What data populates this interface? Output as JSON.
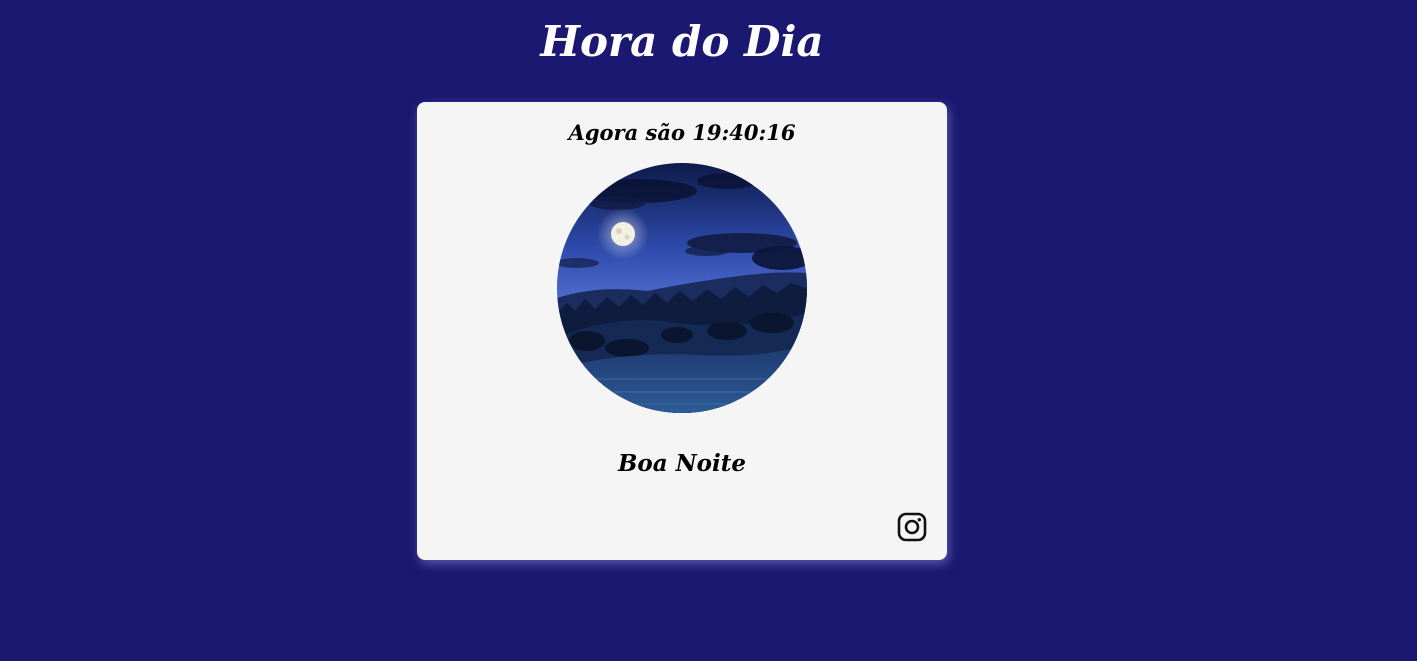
{
  "header": {
    "title": "Hora do Dia"
  },
  "clock": {
    "prefix": "Agora são",
    "time": "19:40:16"
  },
  "image": {
    "icon": "night-landscape-image"
  },
  "greeting": {
    "text": "Boa Noite"
  },
  "social": {
    "icon": "instagram-icon"
  },
  "colors": {
    "background": "#1a1870",
    "card": "#f5f5f5",
    "title": "#ffffff",
    "text": "#000000"
  }
}
